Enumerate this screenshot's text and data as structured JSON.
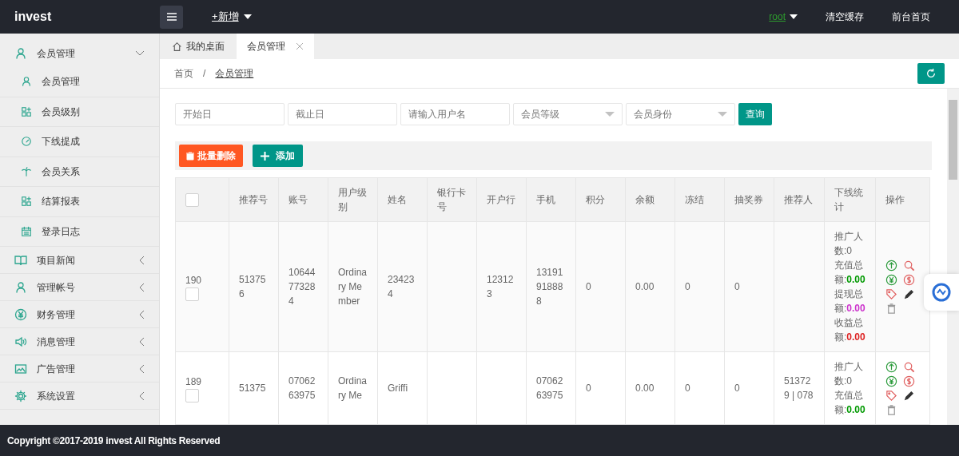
{
  "header": {
    "logo": "invest",
    "add_menu": "+新增",
    "user": "root",
    "links": [
      "清空缓存",
      "前台首页"
    ]
  },
  "sidebar": [
    {
      "label": "会员管理",
      "expanded": true,
      "children": [
        {
          "label": "会员管理"
        },
        {
          "label": "会员级别"
        },
        {
          "label": "下线提成"
        },
        {
          "label": "会员关系"
        },
        {
          "label": "结算报表"
        },
        {
          "label": "登录日志"
        }
      ]
    },
    {
      "label": "项目新闻",
      "expanded": false
    },
    {
      "label": "管理帐号",
      "expanded": false
    },
    {
      "label": "财务管理",
      "expanded": false
    },
    {
      "label": "消息管理",
      "expanded": false
    },
    {
      "label": "广告管理",
      "expanded": false
    },
    {
      "label": "系统设置",
      "expanded": false
    }
  ],
  "tabs": [
    {
      "label": "我的桌面",
      "kind": "home",
      "selected": false
    },
    {
      "label": "会员管理",
      "kind": "closable",
      "selected": true
    }
  ],
  "breadcrumb": [
    "首页",
    "会员管理"
  ],
  "breadcrumb_separator": "/",
  "filters": [
    {
      "kind": "input",
      "placeholder": "开始日"
    },
    {
      "kind": "input",
      "placeholder": "截止日"
    },
    {
      "kind": "input",
      "placeholder": "请输入用户名"
    },
    {
      "kind": "select",
      "placeholder": "会员等级"
    },
    {
      "kind": "select",
      "placeholder": "会员身份"
    }
  ],
  "search_button": "查询",
  "toolbar": [
    {
      "kind": "delete",
      "label": "批量删除"
    },
    {
      "kind": "add",
      "label": "添加"
    }
  ],
  "table": {
    "select_all_checked": false,
    "columns": [
      "推荐号",
      "账号",
      "用户级别",
      "姓名",
      "银行卡号",
      "开户行",
      "手机",
      "积分",
      "余额",
      "冻结",
      "抽奖券",
      "推荐人",
      "下线统计",
      "操作"
    ],
    "rows": [
      {
        "id": "190",
        "checked": false,
        "referral_no": "513756",
        "account": "10644773284",
        "level": "Ordinary Member",
        "name": "234234",
        "bank": "123123",
        "phone": "13191918888",
        "points": "0",
        "balance": "0.00",
        "frozen": "0",
        "coupons": "0",
        "stats": [
          {
            "label": "推广人数:",
            "value": "0"
          },
          {
            "label": "充值总额:",
            "value": "0.00",
            "color": "#009900"
          },
          {
            "label": "提现总额:",
            "value": "0.00",
            "color": "#cc33cc"
          },
          {
            "label": "收益总额:",
            "value": "0.00",
            "color": "#dd2222"
          }
        ]
      },
      {
        "id": "189",
        "checked": false,
        "referral_no": "51375",
        "account": "0706263975",
        "level": "Ordinary Me",
        "name": "Griffi",
        "phone": "0706263975",
        "points": "0",
        "balance": "0.00",
        "frozen": "0",
        "coupons": "0",
        "referrer": "513729 | 078",
        "stats": [
          {
            "label": "推广人数:",
            "value": "0"
          },
          {
            "label": "充值总额:",
            "value": "0.00",
            "color": "#009900"
          }
        ]
      }
    ]
  },
  "footer": "Copyright ©2017-2019 invest All Rights Reserved"
}
